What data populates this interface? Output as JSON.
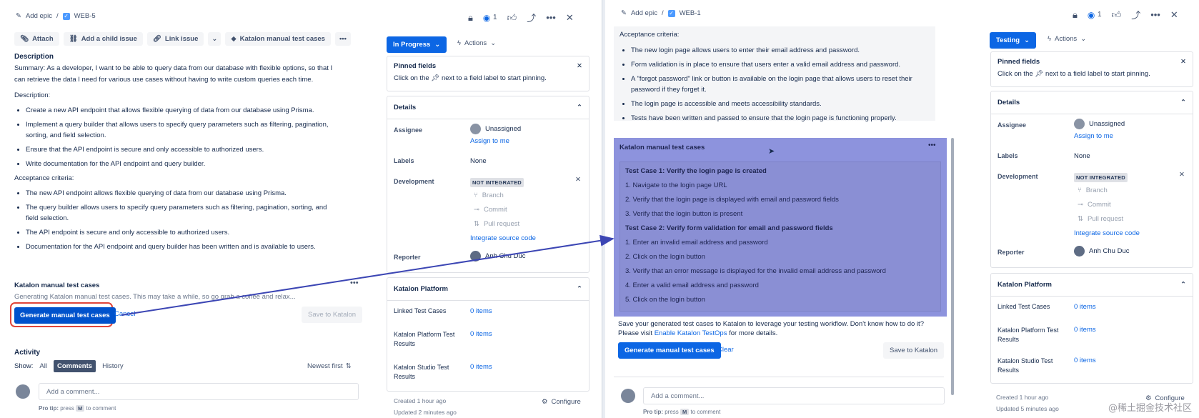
{
  "left": {
    "breadcrumb": {
      "add_epic": "Add epic",
      "sep": "/",
      "issue_key": "WEB-5"
    },
    "watch_count": "1",
    "toolbar": {
      "attach": "Attach",
      "add_child": "Add a child issue",
      "link_issue": "Link issue",
      "katalon": "Katalon manual test cases"
    },
    "description": {
      "heading": "Description",
      "summary": "Summary: As a developer, I want to be able to query data from our database with flexible options, so that I can retrieve the data I need for various use cases without having to write custom queries each time.",
      "sub_heading": "Description:",
      "items": [
        "Create a new API endpoint that allows flexible querying of data from our database using Prisma.",
        "Implement a query builder that allows users to specify query parameters such as filtering, pagination, sorting, and field selection.",
        "Ensure that the API endpoint is secure and only accessible to authorized users.",
        "Write documentation for the API endpoint and query builder."
      ],
      "acceptance_heading": "Acceptance criteria:",
      "acceptance": [
        "The new API endpoint allows flexible querying of data from our database using Prisma.",
        "The query builder allows users to specify query parameters such as filtering, pagination, sorting, and field selection.",
        "The API endpoint is secure and only accessible to authorized users.",
        "Documentation for the API endpoint and query builder has been written and is available to users."
      ]
    },
    "katalon": {
      "title": "Katalon manual test cases",
      "generating": "Generating Katalon manual test cases. This may take a while, so go grab a coffee and relax...",
      "generate": "Generate manual test cases",
      "cancel": "Cancel",
      "save": "Save to Katalon"
    },
    "activity": {
      "heading": "Activity",
      "show": "Show:",
      "tabs": [
        "All",
        "Comments",
        "History"
      ],
      "sort": "Newest first",
      "comment_placeholder": "Add a comment...",
      "pro_tip_a": "Pro tip:",
      "pro_tip_b": "press",
      "pro_tip_key": "M",
      "pro_tip_c": "to comment"
    },
    "status": "In Progress",
    "actions": "Actions",
    "pinned": {
      "title": "Pinned fields",
      "text_a": "Click on the",
      "text_b": "next to a field label to start pinning."
    },
    "details": {
      "title": "Details",
      "assignee_label": "Assignee",
      "assignee": "Unassigned",
      "assign_me": "Assign to me",
      "labels_label": "Labels",
      "labels": "None",
      "dev_label": "Development",
      "dev_badge": "NOT INTEGRATED",
      "branch": "Branch",
      "commit": "Commit",
      "pr": "Pull request",
      "integrate": "Integrate source code",
      "reporter_label": "Reporter",
      "reporter": "Anh Chu Duc"
    },
    "platform": {
      "title": "Katalon Platform",
      "rows": [
        {
          "label": "Linked Test Cases",
          "value": "0 items"
        },
        {
          "label": "Katalon Platform Test Results",
          "value": "0 items"
        },
        {
          "label": "Katalon Studio Test Results",
          "value": "0 items"
        }
      ]
    },
    "created": "Created 1 hour ago",
    "updated": "Updated 2 minutes ago",
    "configure": "Configure"
  },
  "right": {
    "breadcrumb": {
      "add_epic": "Add epic",
      "sep": "/",
      "issue_key": "WEB-1"
    },
    "watch_count": "1",
    "acceptance_heading": "Acceptance criteria:",
    "acceptance": [
      "The new login page allows users to enter their email address and password.",
      "Form validation is in place to ensure that users enter a valid email address and password.",
      "A \"forgot password\" link or button is available on the login page that allows users to reset their password if they forget it.",
      "The login page is accessible and meets accessibility standards.",
      "Tests have been written and passed to ensure that the login page is functioning properly."
    ],
    "katalon": {
      "title": "Katalon manual test cases",
      "lines": [
        {
          "t": "Test Case 1: Verify the login page is created",
          "bold": true
        },
        {
          "t": "1. Navigate to the login page URL",
          "bold": false
        },
        {
          "t": "2. Verify that the login page is displayed with email and password fields",
          "bold": false
        },
        {
          "t": "3. Verify that the login button is present",
          "bold": false
        },
        {
          "t": "Test Case 2: Verify form validation for email and password fields",
          "bold": true
        },
        {
          "t": "1. Enter an invalid email address and password",
          "bold": false
        },
        {
          "t": "2. Click on the login button",
          "bold": false
        },
        {
          "t": "3. Verify that an error message is displayed for the invalid email address and password",
          "bold": false
        },
        {
          "t": "4. Enter a valid email address and password",
          "bold": false
        },
        {
          "t": "5. Click on the login button",
          "bold": false
        }
      ],
      "save_note_a": "Save your generated test cases to Katalon to leverage your testing workflow. Don't know how to do it? Please visit",
      "save_note_link": "Enable Katalon TestOps",
      "save_note_b": "for more details.",
      "generate": "Generate manual test cases",
      "clear": "Clear",
      "save": "Save to Katalon"
    },
    "comment_placeholder": "Add a comment...",
    "pro_tip_a": "Pro tip:",
    "pro_tip_b": "press",
    "pro_tip_key": "M",
    "pro_tip_c": "to comment",
    "status": "Testing",
    "actions": "Actions",
    "pinned": {
      "title": "Pinned fields",
      "text_a": "Click on the",
      "text_b": "next to a field label to start pinning."
    },
    "details": {
      "title": "Details",
      "assignee_label": "Assignee",
      "assignee": "Unassigned",
      "assign_me": "Assign to me",
      "labels_label": "Labels",
      "labels": "None",
      "dev_label": "Development",
      "dev_badge": "NOT INTEGRATED",
      "branch": "Branch",
      "commit": "Commit",
      "pr": "Pull request",
      "integrate": "Integrate source code",
      "reporter_label": "Reporter",
      "reporter": "Anh Chu Duc"
    },
    "platform": {
      "title": "Katalon Platform",
      "rows": [
        {
          "label": "Linked Test Cases",
          "value": "0 items"
        },
        {
          "label": "Katalon Platform Test Results",
          "value": "0 items"
        },
        {
          "label": "Katalon Studio Test Results",
          "value": "0 items"
        }
      ]
    },
    "created": "Created 1 hour ago",
    "updated": "Updated 5 minutes ago",
    "configure": "Configure"
  },
  "watermark": "@稀土掘金技术社区",
  "colors": {
    "primary": "#0c66e4",
    "highlight": "#8d93dd",
    "arrow": "#3c46b4",
    "callout": "#e0453a"
  }
}
